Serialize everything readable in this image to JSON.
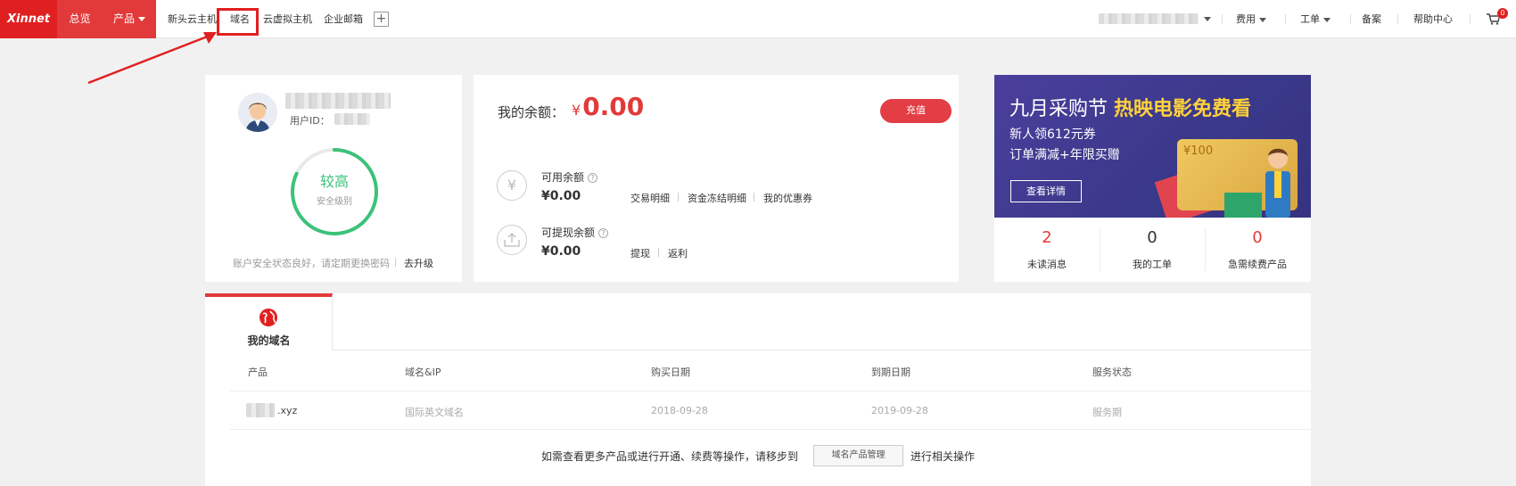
{
  "brand": {
    "logo_text": "Xinnet",
    "primary_color": "#e02020",
    "accent_red": "#e23a3a",
    "success_green": "#3cc27a"
  },
  "main_nav": {
    "overview": "总览",
    "products": "产品"
  },
  "quick_nav": {
    "items": [
      "新头云主机",
      "域名",
      "云虚拟主机",
      "企业邮箱"
    ],
    "add_symbol": "+"
  },
  "top_right": {
    "fees": "费用",
    "tickets": "工单",
    "icp": "备案",
    "help": "帮助中心",
    "cart_count": "0"
  },
  "profile": {
    "uid_label": "用户ID：",
    "security_level": "较高",
    "security_label": "安全级别",
    "security_progress": 0.82,
    "security_tip": "账户安全状态良好，请定期更换密码",
    "upgrade_link": "去升级"
  },
  "balance": {
    "label": "我的余额：",
    "currency": "¥",
    "amount": "0.00",
    "recharge": "充值",
    "available": {
      "title": "可用余额",
      "value": "¥0.00",
      "icon": "yen-icon",
      "links": [
        "交易明细",
        "资金冻结明细",
        "我的优惠券"
      ]
    },
    "withdrawable": {
      "title": "可提现余额",
      "value": "¥0.00",
      "icon": "upload-icon",
      "links": [
        "提现",
        "返利"
      ]
    }
  },
  "promo": {
    "title_part1": "九月采购节",
    "title_part2": "热映电影免费看",
    "line1": "新人领612元券",
    "line2": "订单满减+年限买赠",
    "button": "查看详情",
    "ticket_text": "¥100"
  },
  "stats": [
    {
      "value": "2",
      "label": "未读消息"
    },
    {
      "value": "0",
      "label": "我的工单"
    },
    {
      "value": "0",
      "label": "急需续费产品"
    }
  ],
  "domains": {
    "tab_label": "我的域名",
    "columns": [
      "产品",
      "域名&IP",
      "购买日期",
      "到期日期",
      "服务状态"
    ],
    "rows": [
      {
        "product": ".xyz",
        "type": "国际英文域名",
        "buy_date": "2018-09-28",
        "expire_date": "2019-09-28",
        "status": "服务期"
      }
    ],
    "footer_tip": "如需查看更多产品或进行开通、续费等操作，请移步到",
    "footer_button": "域名产品管理",
    "footer_tip2": "进行相关操作"
  }
}
